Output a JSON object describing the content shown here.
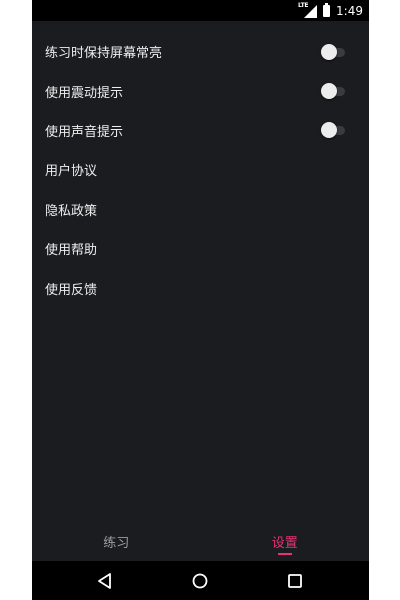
{
  "status_bar": {
    "network": "LTE",
    "time": "1:49"
  },
  "settings": {
    "items": [
      {
        "label": "练习时保持屏幕常亮",
        "toggle": "off"
      },
      {
        "label": "使用震动提示",
        "toggle": "off"
      },
      {
        "label": "使用声音提示",
        "toggle": "off"
      },
      {
        "label": "用户协议"
      },
      {
        "label": "隐私政策"
      },
      {
        "label": "使用帮助"
      },
      {
        "label": "使用反馈"
      }
    ]
  },
  "bottom_tabs": {
    "tabs": [
      {
        "label": "练习",
        "active": false
      },
      {
        "label": "设置",
        "active": true
      }
    ]
  },
  "colors": {
    "background": "#1b1c20",
    "accent": "#e8336f",
    "text": "#eeeeee",
    "inactive_tab": "#9e9e9e"
  },
  "icons": {
    "back": "triangle-back-icon",
    "home": "circle-home-icon",
    "recents": "square-recents-icon"
  }
}
